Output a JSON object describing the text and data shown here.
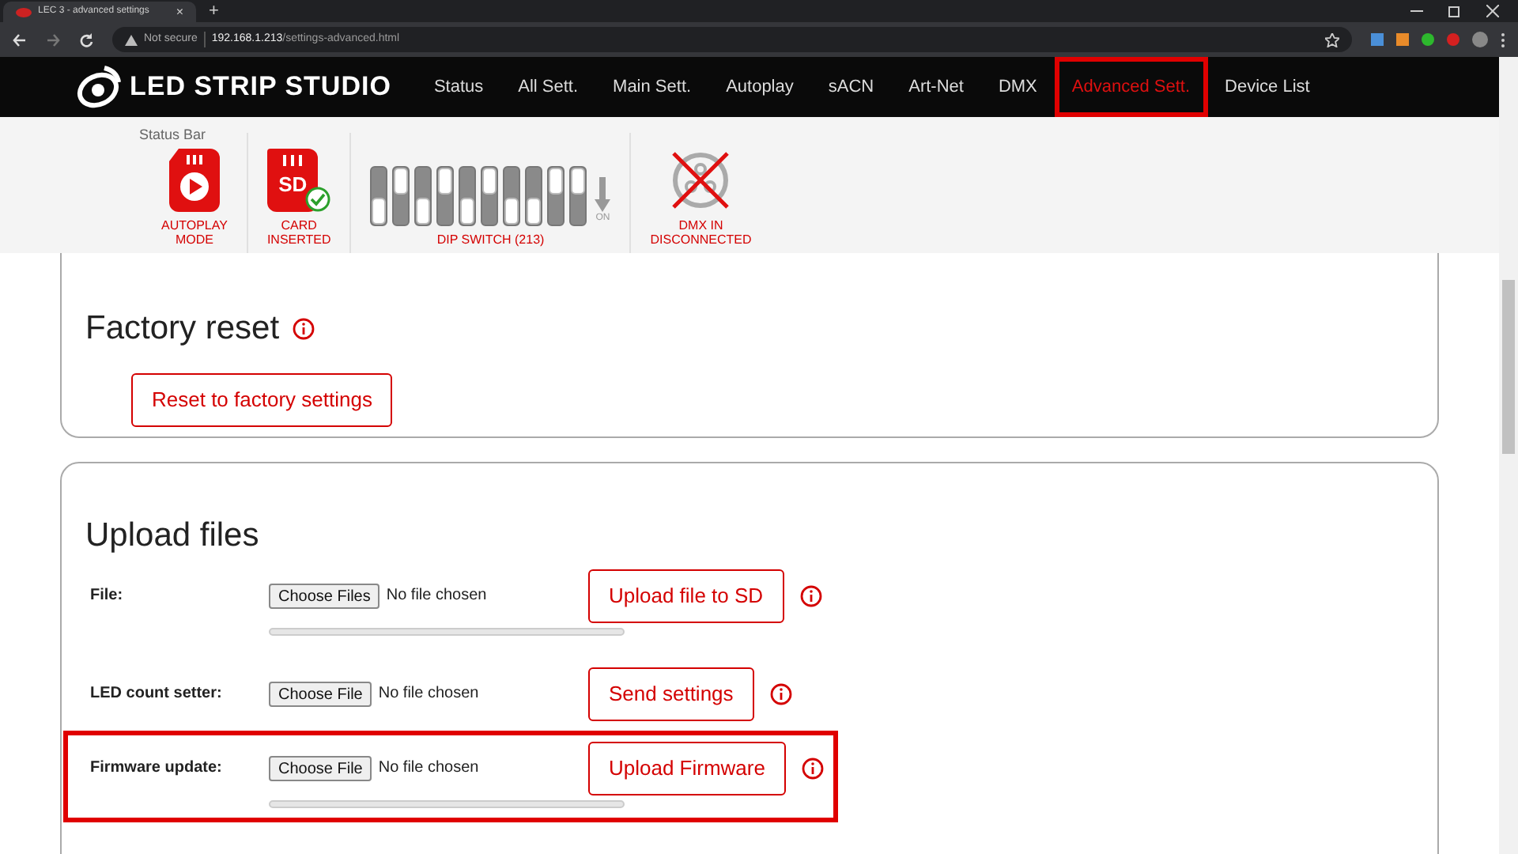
{
  "browser": {
    "tab_title": "LEC 3 - advanced settings",
    "new_tab": "+",
    "close_tab": "×",
    "warning": "Not secure",
    "host": "192.168.1.213",
    "path": "/settings-advanced.html"
  },
  "nav": {
    "logo": "LED STRIP STUDIO",
    "items": [
      {
        "label": "Status",
        "selected": false,
        "highlighted": false
      },
      {
        "label": "All Sett.",
        "selected": false,
        "highlighted": false
      },
      {
        "label": "Main Sett.",
        "selected": false,
        "highlighted": false
      },
      {
        "label": "Autoplay",
        "selected": false,
        "highlighted": false
      },
      {
        "label": "sACN",
        "selected": false,
        "highlighted": false
      },
      {
        "label": "Art-Net",
        "selected": false,
        "highlighted": false
      },
      {
        "label": "DMX",
        "selected": false,
        "highlighted": false
      },
      {
        "label": "Advanced Sett.",
        "selected": true,
        "highlighted": true
      },
      {
        "label": "Device List",
        "selected": false,
        "highlighted": false
      }
    ]
  },
  "status_bar": {
    "label": "Status Bar",
    "items": [
      {
        "kind": "autoplay",
        "label": [
          "AUTOPLAY",
          "MODE"
        ]
      },
      {
        "kind": "card",
        "badge": "SD",
        "label": [
          "CARD",
          "INSERTED"
        ]
      },
      {
        "kind": "dip",
        "label": [
          "DIP SWITCH (213)"
        ],
        "on_label": "ON",
        "switches": [
          {
            "on": true
          },
          {
            "on": false
          },
          {
            "on": true
          },
          {
            "on": false
          },
          {
            "on": true
          },
          {
            "on": false
          },
          {
            "on": true
          },
          {
            "on": true
          },
          {
            "on": false
          },
          {
            "on": false
          }
        ]
      },
      {
        "kind": "dmx",
        "label": [
          "DMX IN",
          "DISCONNECTED"
        ]
      }
    ]
  },
  "factory_reset": {
    "title": "Factory reset",
    "button": "Reset to factory settings"
  },
  "upload": {
    "title": "Upload files",
    "rows": [
      {
        "label": "File:",
        "choose": "Choose Files",
        "status": "No file chosen",
        "button": "Upload file to SD",
        "progress": true,
        "highlighted": false
      },
      {
        "label": "LED count setter:",
        "choose": "Choose File",
        "status": "No file chosen",
        "button": "Send settings",
        "progress": false,
        "highlighted": false
      },
      {
        "label": "Firmware update:",
        "choose": "Choose File",
        "status": "No file chosen",
        "button": "Upload Firmware",
        "progress": true,
        "highlighted": true
      }
    ]
  }
}
